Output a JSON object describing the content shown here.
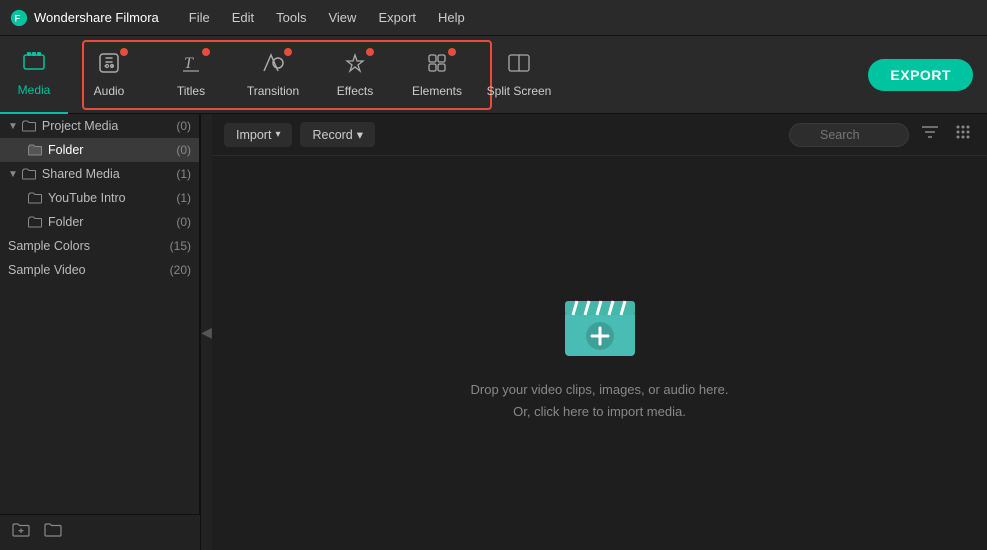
{
  "titlebar": {
    "app_name": "Wondershare Filmora",
    "menu_items": [
      "File",
      "Edit",
      "Tools",
      "View",
      "Export",
      "Help"
    ]
  },
  "toolbar": {
    "export_label": "EXPORT",
    "items": [
      {
        "id": "media",
        "label": "Media",
        "icon": "🎬",
        "active": true,
        "has_dot": false
      },
      {
        "id": "audio",
        "label": "Audio",
        "icon": "♪",
        "active": false,
        "has_dot": true
      },
      {
        "id": "titles",
        "label": "Titles",
        "icon": "T",
        "active": false,
        "has_dot": true
      },
      {
        "id": "transition",
        "label": "Transition",
        "icon": "✦",
        "active": false,
        "has_dot": true
      },
      {
        "id": "effects",
        "label": "Effects",
        "icon": "✧",
        "active": false,
        "has_dot": true
      },
      {
        "id": "elements",
        "label": "Elements",
        "icon": "⬡",
        "active": false,
        "has_dot": true
      },
      {
        "id": "split_screen",
        "label": "Split Screen",
        "icon": "⊞",
        "active": false,
        "has_dot": false
      }
    ]
  },
  "content_toolbar": {
    "import_label": "Import",
    "record_label": "Record",
    "search_placeholder": "Search"
  },
  "sidebar": {
    "sections": [
      {
        "id": "project_media",
        "label": "Project Media",
        "count": "(0)",
        "expanded": true,
        "children": [
          {
            "id": "folder",
            "label": "Folder",
            "count": "(0)",
            "selected": true
          }
        ]
      },
      {
        "id": "shared_media",
        "label": "Shared Media",
        "count": "(1)",
        "expanded": true,
        "children": [
          {
            "id": "youtube_intro",
            "label": "YouTube Intro",
            "count": "(1)"
          },
          {
            "id": "folder2",
            "label": "Folder",
            "count": "(0)"
          }
        ]
      },
      {
        "id": "sample_colors",
        "label": "Sample Colors",
        "count": "(15)"
      },
      {
        "id": "sample_video",
        "label": "Sample Video",
        "count": "(20)"
      }
    ]
  },
  "drop_area": {
    "line1": "Drop your video clips, images, or audio here.",
    "line2": "Or, click here to import media."
  }
}
